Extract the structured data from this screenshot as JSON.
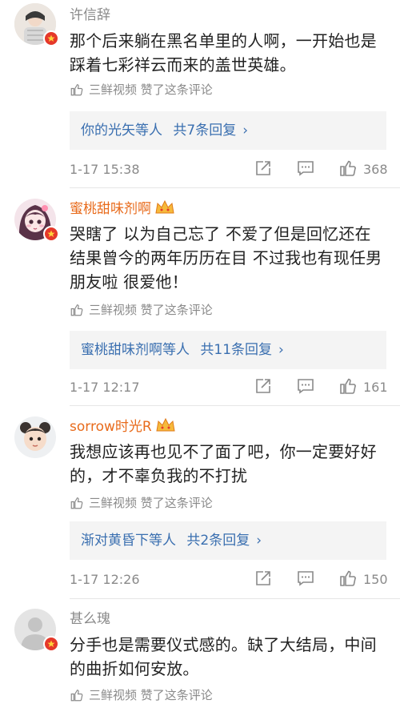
{
  "comments": [
    {
      "username": "许信辞",
      "text": "那个后来躺在黑名单里的人啊，一开始也是踩着七彩祥云而来的盖世英雄。",
      "liked_by": "三鲜视频 赞了这条评论",
      "replies": "你的光矢等人",
      "reply_count": "共7条回复",
      "time": "1-17 15:38",
      "likes": "368"
    },
    {
      "username": "蜜桃甜味剂啊",
      "text": "哭瞎了 以为自己忘了 不爱了但是回忆还在 结果曾今的两年历历在目 不过我也有现任男朋友啦 很爱他！",
      "liked_by": "三鲜视频 赞了这条评论",
      "replies": "蜜桃甜味剂啊等人",
      "reply_count": "共11条回复",
      "time": "1-17 12:17",
      "likes": "161"
    },
    {
      "username": "sorrow时光R",
      "text": "我想应该再也见不了面了吧，你一定要好好的，才不辜负我的不打扰",
      "liked_by": "三鲜视频 赞了这条评论",
      "replies": "渐对黄昏下等人",
      "reply_count": "共2条回复",
      "time": "1-17 12:26",
      "likes": "150"
    },
    {
      "username": "甚么瑰",
      "text": "分手也是需要仪式感的。缺了大结局，中间的曲折如何安放。",
      "liked_by": "三鲜视频 赞了这条评论"
    }
  ],
  "colors": {
    "link": "#3a6fb0",
    "vip_name": "#e86b1c",
    "badge": "#e5382a",
    "muted": "#8a8a8a"
  },
  "icons": [
    "repost-icon",
    "comment-icon",
    "like-icon",
    "vip-crown-icon",
    "verified-badge-icon"
  ]
}
